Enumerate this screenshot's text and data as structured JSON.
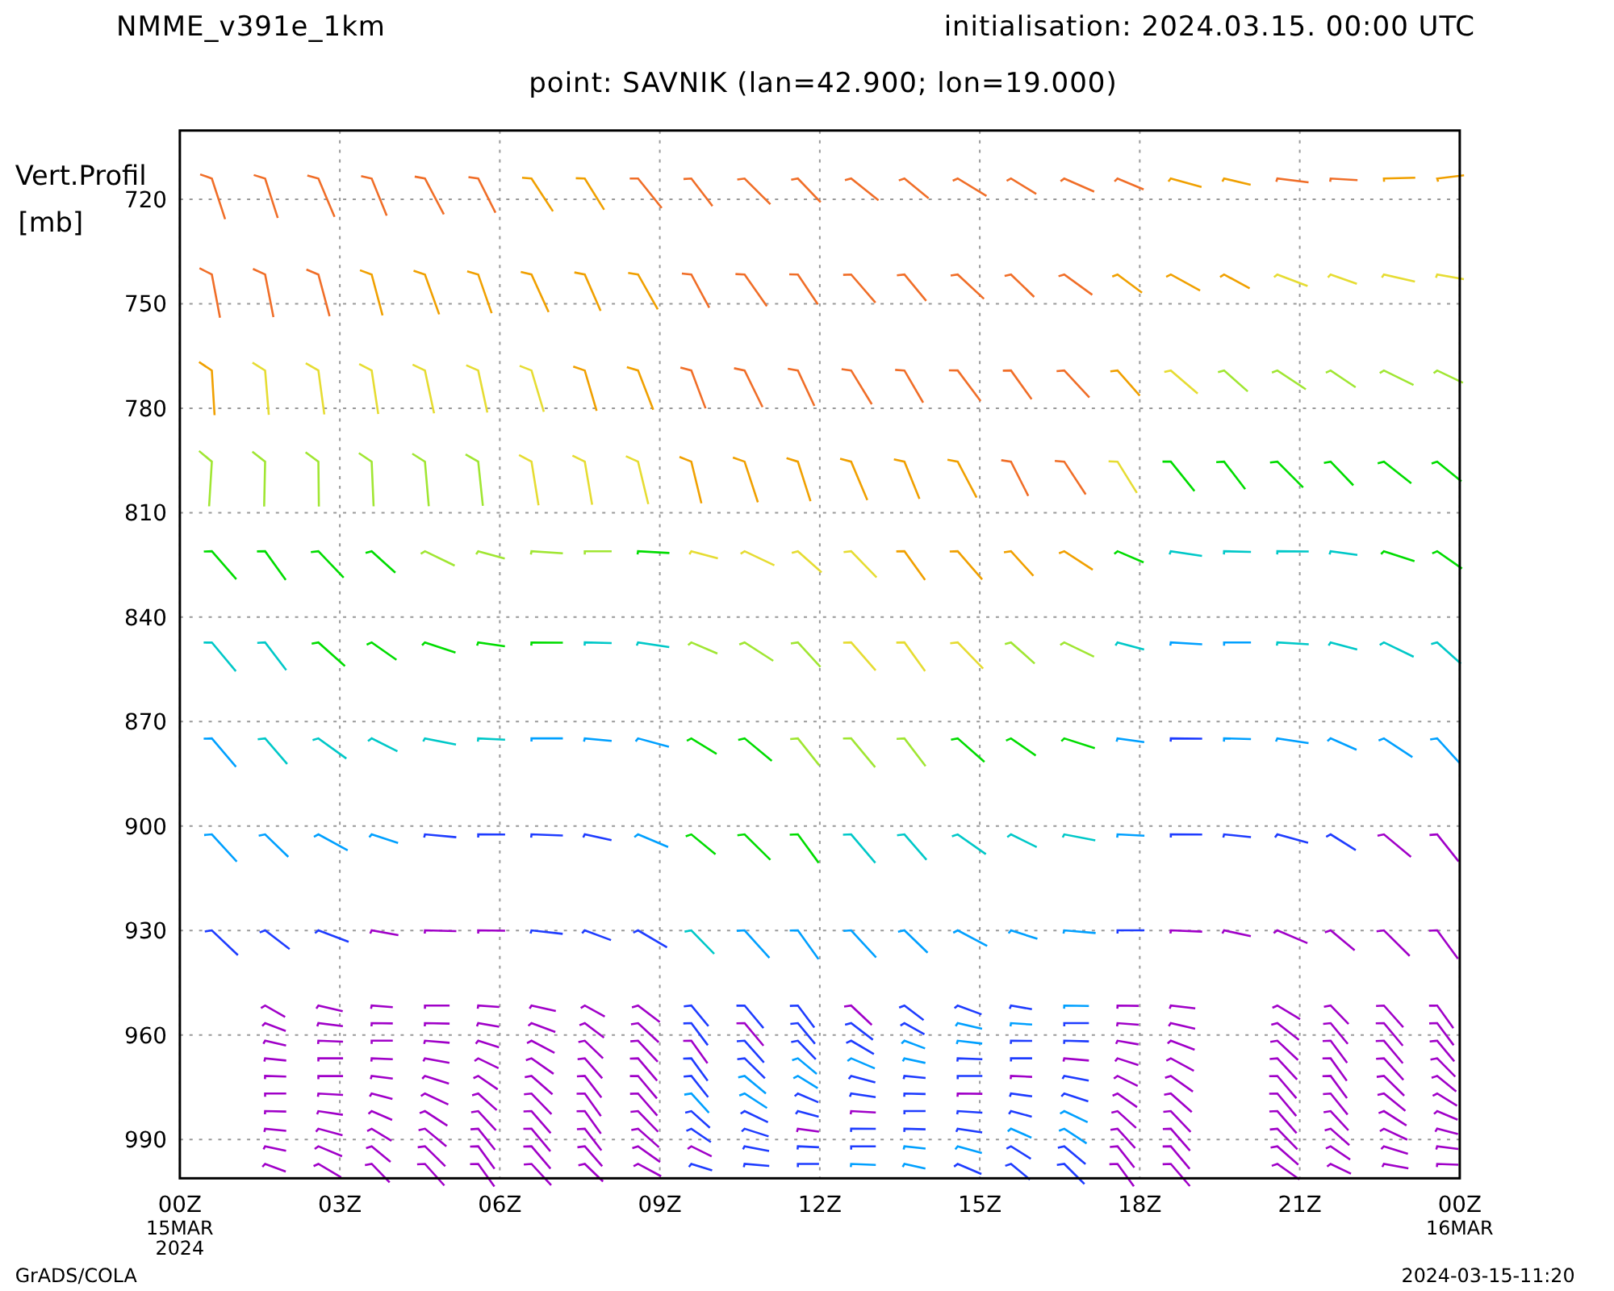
{
  "header": {
    "model": "NMME_v391e_1km",
    "initialisation": "initialisation: 2024.03.15. 00:00 UTC",
    "point": "point: SAVNIK (lan=42.900; lon=19.000)"
  },
  "y_axis": {
    "title": "Vert.Profil",
    "unit": "[mb]",
    "ticks": [
      "720",
      "750",
      "780",
      "810",
      "840",
      "870",
      "900",
      "930",
      "960",
      "990"
    ]
  },
  "x_axis": {
    "ticks": [
      "00Z",
      "03Z",
      "06Z",
      "09Z",
      "12Z",
      "15Z",
      "18Z",
      "21Z",
      "00Z"
    ],
    "start_date": [
      "15MAR",
      "2024"
    ],
    "end_date": "16MAR"
  },
  "footer": {
    "left": "GrADS/COLA",
    "right": "2024-03-15-11:20"
  }
}
